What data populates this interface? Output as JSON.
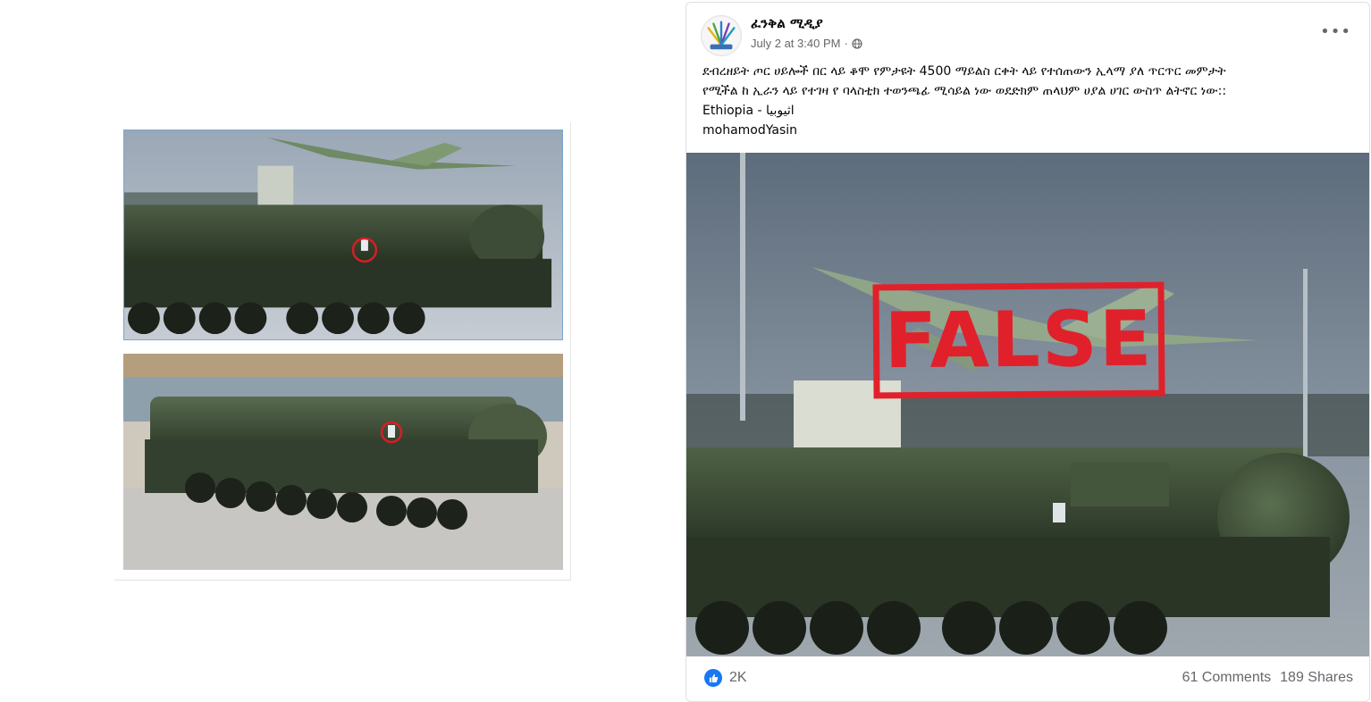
{
  "post": {
    "page_name": "ፈንቅል ሚዲያ",
    "timestamp": "July 2 at 3:40 PM",
    "separator": "·",
    "more_label": "•••",
    "text_lines": [
      "ደብረዘይት ጦር ሀይሎች በር ላይ ቆሞ የምታዩት 4500 ማይልስ ርቀት ላይ የተሰጠውን ኢላማ ያለ ጥርጥር መምታት",
      "የሚችል ከ ኢራን ላይ የተገዛ የ ባላስቲክ ተወንጫፊ ሚሳይል ነው ወደድክም ጠላህም ሀያል ሀገር ውስጥ ልትኖር ነው::",
      "Ethiopia - اثيوبيا",
      "mohamodYasin"
    ],
    "stamp_label": "FALSE",
    "reactions": "2K",
    "comments": "61 Comments",
    "shares": "189 Shares"
  },
  "icons": {
    "avatar": "page-logo",
    "privacy": "globe-icon",
    "like": "thumbs-up-icon"
  },
  "colors": {
    "stamp_red": "#e0212b",
    "facebook_blue": "#1877f2",
    "missile_green": "#3c4d36",
    "circle_marker": "#d81e24"
  }
}
